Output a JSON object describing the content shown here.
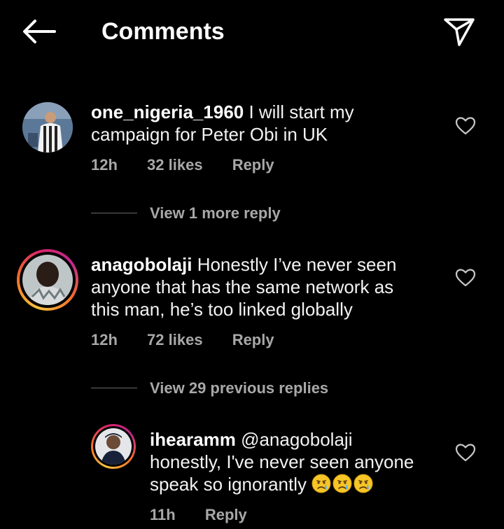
{
  "header": {
    "title": "Comments"
  },
  "comments": [
    {
      "username": "one_nigeria_1960",
      "text_line1": " I will start my",
      "text_line2": "campaign for Peter Obi in UK",
      "time": "12h",
      "likes": "32 likes",
      "reply": "Reply",
      "view_replies": "View 1 more reply"
    },
    {
      "username": "anagobolaji",
      "text_line1": " Honestly I’ve never seen",
      "text_line2": "anyone that has the same network as",
      "text_line3": "this man, he’s too linked globally",
      "time": "12h",
      "likes": "72 likes",
      "reply": "Reply",
      "view_replies": "View 29 previous replies"
    },
    {
      "username": "ihearamm",
      "text_line1": " @anagobolaji",
      "text_line2": "honestly, I've never seen anyone",
      "text_line3": "speak so ignorantly ",
      "emojis": [
        "crying-face-emoji",
        "crying-face-emoji",
        "crying-face-emoji"
      ],
      "time": "11h",
      "reply": "Reply"
    }
  ],
  "colors": {
    "background": "#000000",
    "text": "#ffffff",
    "secondary_text": "#a8a8a8",
    "story_ring": [
      "#f9c33c",
      "#f3702b",
      "#d8246a"
    ]
  }
}
